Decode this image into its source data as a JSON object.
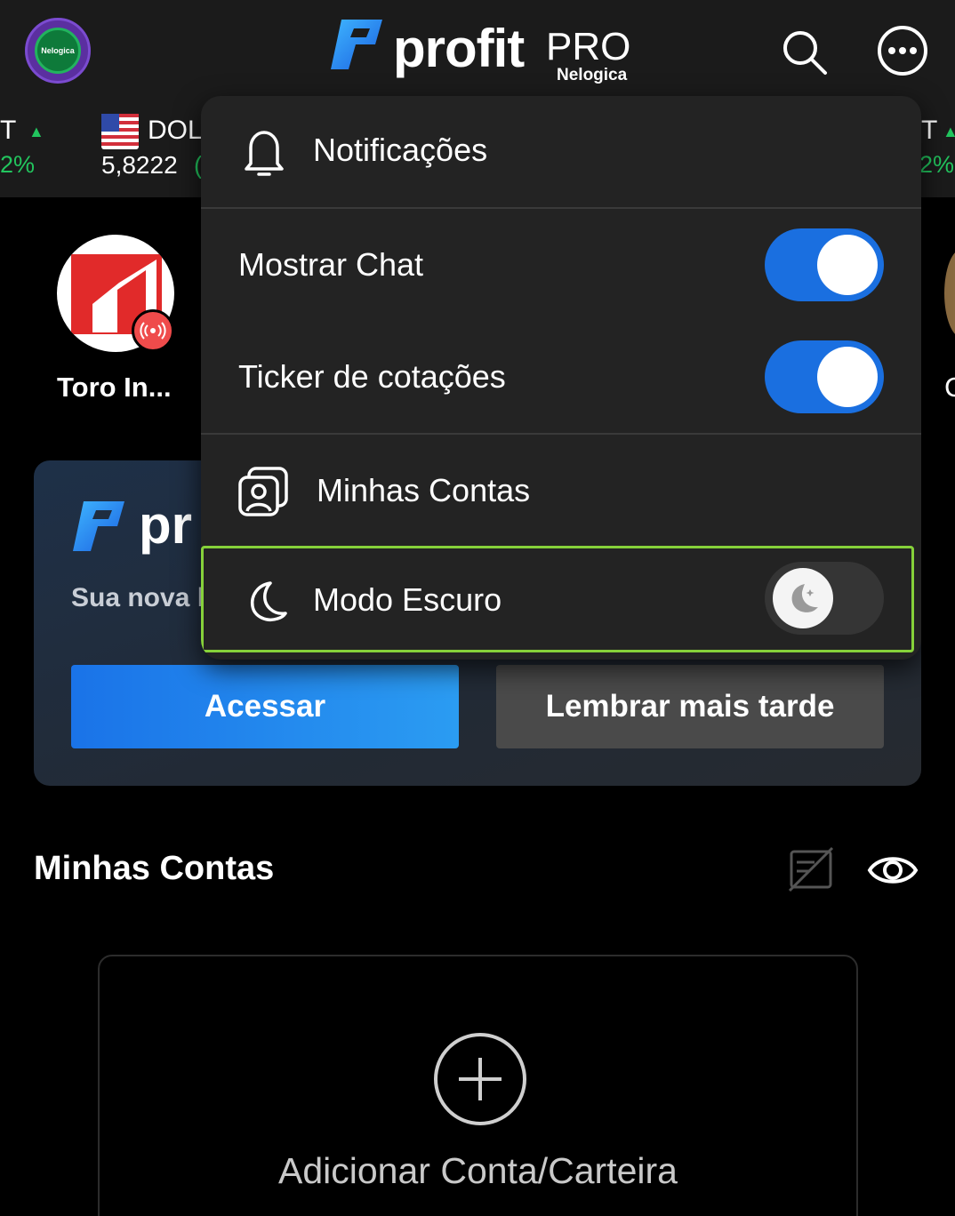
{
  "header": {
    "logo_brand": "profit",
    "logo_suffix": "PRO",
    "logo_sub": "Nelogica",
    "avatar_text": "Nelogica"
  },
  "ticker": {
    "left": {
      "symbol": "T",
      "change": "2%"
    },
    "dol": {
      "symbol": "DOL",
      "value": "5,8222",
      "change": "("
    },
    "right": {
      "symbol": "T",
      "change": "2%"
    }
  },
  "stories": [
    {
      "label": "Toro In..."
    },
    {
      "label": "C"
    }
  ],
  "promo": {
    "logo_text": "pr",
    "text": "Sua nova l",
    "access_label": "Acessar",
    "later_label": "Lembrar mais tarde"
  },
  "accounts": {
    "title": "Minhas Contas",
    "add_label": "Adicionar Conta/Carteira"
  },
  "menu": {
    "notifications": "Notificações",
    "show_chat": {
      "label": "Mostrar Chat",
      "enabled": true
    },
    "ticker": {
      "label": "Ticker de cotações",
      "enabled": true
    },
    "my_accounts": "Minhas Contas",
    "dark_mode": {
      "label": "Modo Escuro",
      "enabled": false
    }
  },
  "colors": {
    "accent_blue": "#1a6fe0",
    "positive_green": "#22c55e",
    "highlight_green": "#86d13a",
    "live_red": "#ef4b4b"
  },
  "icons": [
    "search-icon",
    "more-icon",
    "bell-icon",
    "accounts-icon",
    "moon-icon",
    "live-icon",
    "hide-values-icon",
    "eye-icon",
    "add-icon"
  ]
}
